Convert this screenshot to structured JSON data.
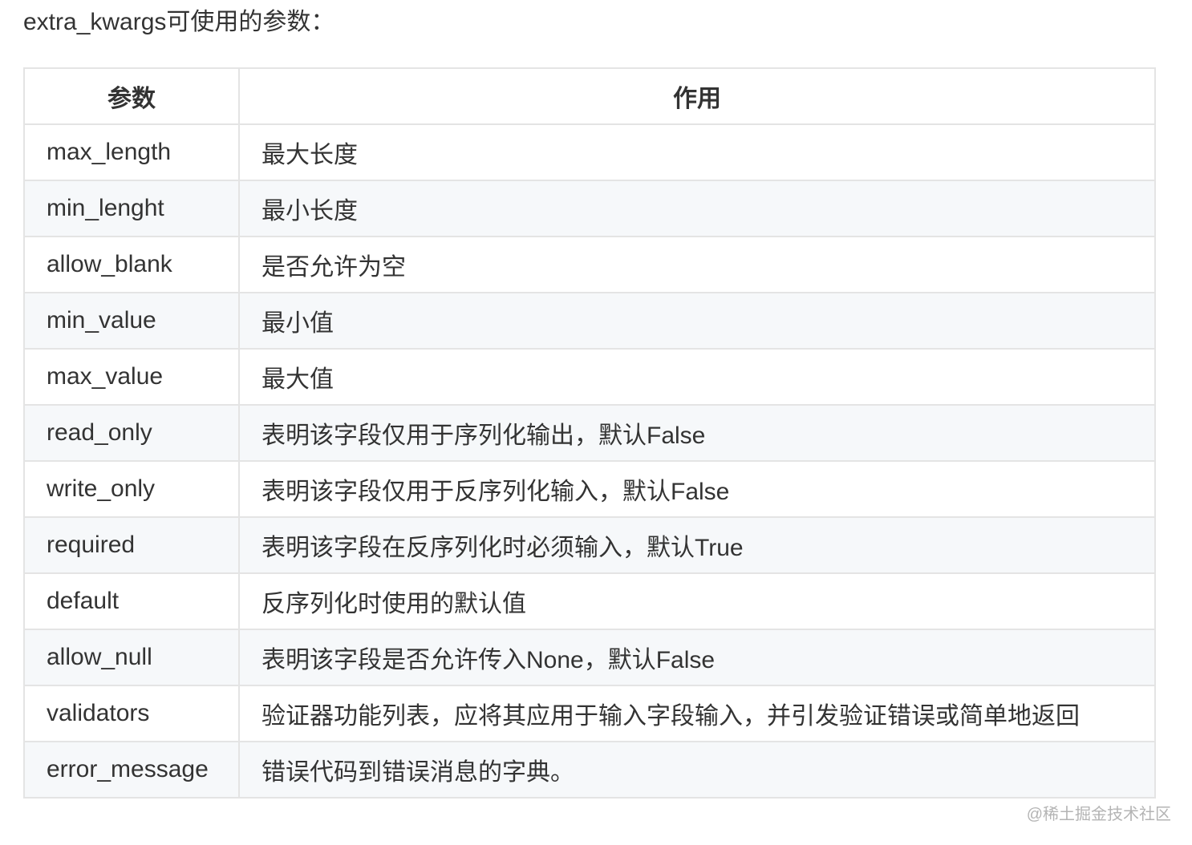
{
  "intro_text": "extra_kwargs可使用的参数：",
  "table": {
    "headers": [
      "参数",
      "作用"
    ],
    "rows": [
      {
        "param": "max_length",
        "effect": "最大长度"
      },
      {
        "param": "min_lenght",
        "effect": "最小长度"
      },
      {
        "param": "allow_blank",
        "effect": "是否允许为空"
      },
      {
        "param": "min_value",
        "effect": "最小值"
      },
      {
        "param": "max_value",
        "effect": "最大值"
      },
      {
        "param": "read_only",
        "effect": "表明该字段仅用于序列化输出，默认False"
      },
      {
        "param": "write_only",
        "effect": "表明该字段仅用于反序列化输入，默认False"
      },
      {
        "param": "required",
        "effect": "表明该字段在反序列化时必须输入，默认True"
      },
      {
        "param": "default",
        "effect": "反序列化时使用的默认值"
      },
      {
        "param": "allow_null",
        "effect": "表明该字段是否允许传入None，默认False"
      },
      {
        "param": "validators",
        "effect": "验证器功能列表，应将其应用于输入字段输入，并引发验证错误或简单地返回"
      },
      {
        "param": "error_message",
        "effect": "错误代码到错误消息的字典。"
      }
    ]
  },
  "watermark": "@稀土掘金技术社区"
}
